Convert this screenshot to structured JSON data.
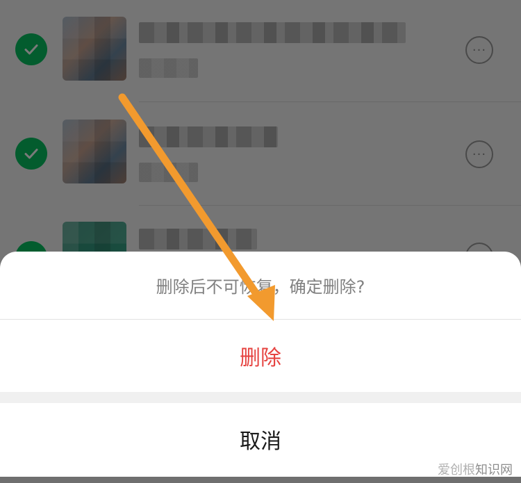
{
  "dialog": {
    "message": "删除后不可恢复，确定删除?",
    "delete_label": "删除",
    "cancel_label": "取消"
  },
  "list": {
    "rows": [
      {
        "selected": true,
        "more_icon": "ellipsis-circle-icon"
      },
      {
        "selected": true,
        "more_icon": "ellipsis-circle-icon"
      },
      {
        "selected": true,
        "more_icon": "ellipsis-circle-icon"
      }
    ]
  },
  "watermark": {
    "brand": "爱创根",
    "site": "知识网"
  },
  "colors": {
    "check": "#07c160",
    "danger": "#e64340",
    "arrow": "#f29a2e"
  }
}
